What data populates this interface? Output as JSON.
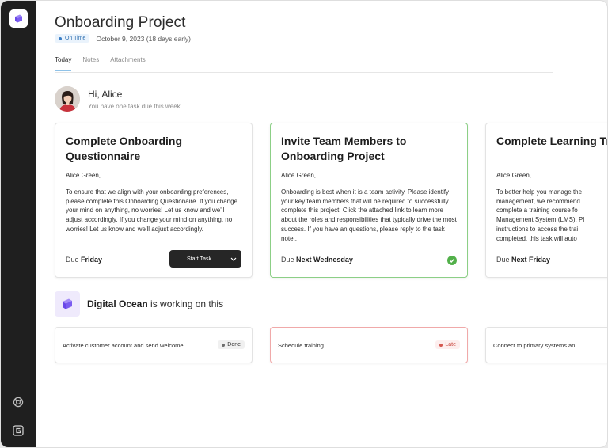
{
  "header": {
    "title": "Onboarding Project",
    "status": "On Time",
    "due": "October 9, 2023 (18 days early)"
  },
  "tabs": [
    {
      "label": "Today",
      "active": true
    },
    {
      "label": "Notes",
      "active": false
    },
    {
      "label": "Attachments",
      "active": false
    }
  ],
  "greeting": {
    "hi": "Hi, Alice",
    "sub": "You have one task due this week"
  },
  "cards": [
    {
      "title": "Complete Onboarding Questionnaire",
      "greeting": "Alice Green,",
      "body": "To ensure that we align with your onboarding preferences, please complete this Onboarding Questionaire. If you change your mind on anything, no worries! Let us know and we'll adjust accordingly. If you change your mind on anything, no worries! Let us know and we'll adjust accordingly.",
      "due_prefix": "Due",
      "due_day": "Friday",
      "button": "Start Task"
    },
    {
      "title": "Invite Team Members to Onboarding Project",
      "greeting": "Alice Green,",
      "body": "Onboarding is best when it is a team activity. Please identify your key team members that will be required to successfully complete this project. Click the attached link to learn more about the roles and responsibilities that typically drive the most success. If you have an questions, please reply to the task note..",
      "due_prefix": "Due",
      "due_day": "Next Wednesday"
    },
    {
      "title": "Complete Learning Training",
      "greeting": "Alice Green,",
      "body": "To better help you manage the management, we recommend complete a training course fo Management System (LMS). Pl instructions to access the trai completed, this task will auto",
      "due_prefix": "Due",
      "due_day": "Next Friday"
    }
  ],
  "partner": {
    "name": "Digital Ocean",
    "suffix": "is working on this"
  },
  "mini_tasks": [
    {
      "label": "Activate customer account and send welcome...",
      "badge": "Done"
    },
    {
      "label": "Schedule training",
      "badge": "Late"
    },
    {
      "label": "Connect to primary systems an"
    }
  ],
  "colors": {
    "sidebar": "#1f1f1f",
    "accent_purple": "#7b5cf0",
    "success_green": "#52b04a",
    "late_red": "#d4574f",
    "on_time_blue": "#2f6fb0"
  }
}
